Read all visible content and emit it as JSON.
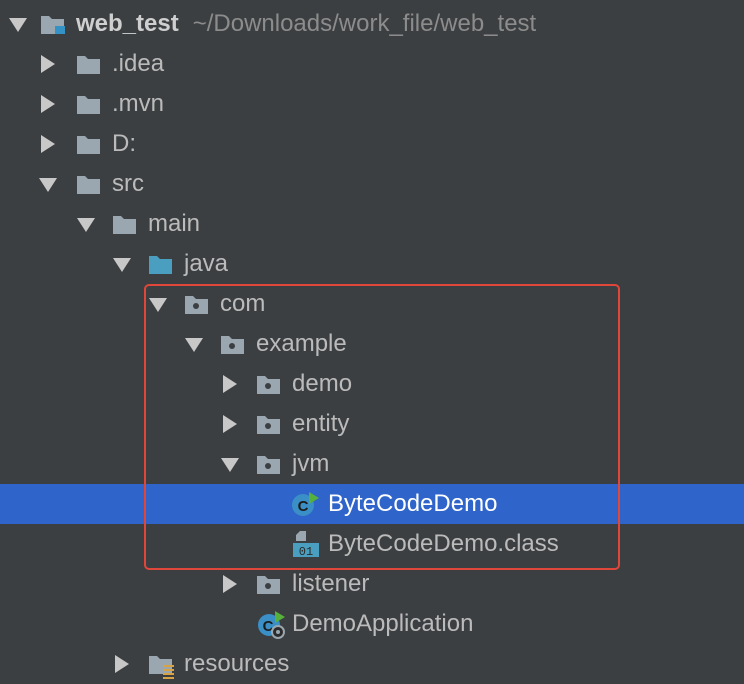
{
  "project": {
    "name": "web_test",
    "path": "~/Downloads/work_file/web_test"
  },
  "tree": {
    "idea": ".idea",
    "mvn": ".mvn",
    "d": "D:",
    "src": "src",
    "main": "main",
    "java": "java",
    "com": "com",
    "example": "example",
    "demo": "demo",
    "entity": "entity",
    "jvm": "jvm",
    "bytecode_demo": "ByteCodeDemo",
    "bytecode_demo_class": "ByteCodeDemo.class",
    "listener": "listener",
    "demo_application": "DemoApplication",
    "resources": "resources"
  },
  "colors": {
    "background": "#3c3f41",
    "selection": "#2f65ca",
    "highlight_border": "#e0463a",
    "folder": "#9aa7b0",
    "source_folder": "#4a9ebf"
  },
  "icons": {
    "collapsed": "triangle-right-icon",
    "expanded": "triangle-down-icon",
    "folder": "folder-icon",
    "package": "package-icon",
    "java_class": "java-class-icon",
    "class_file": "class-file-icon"
  }
}
